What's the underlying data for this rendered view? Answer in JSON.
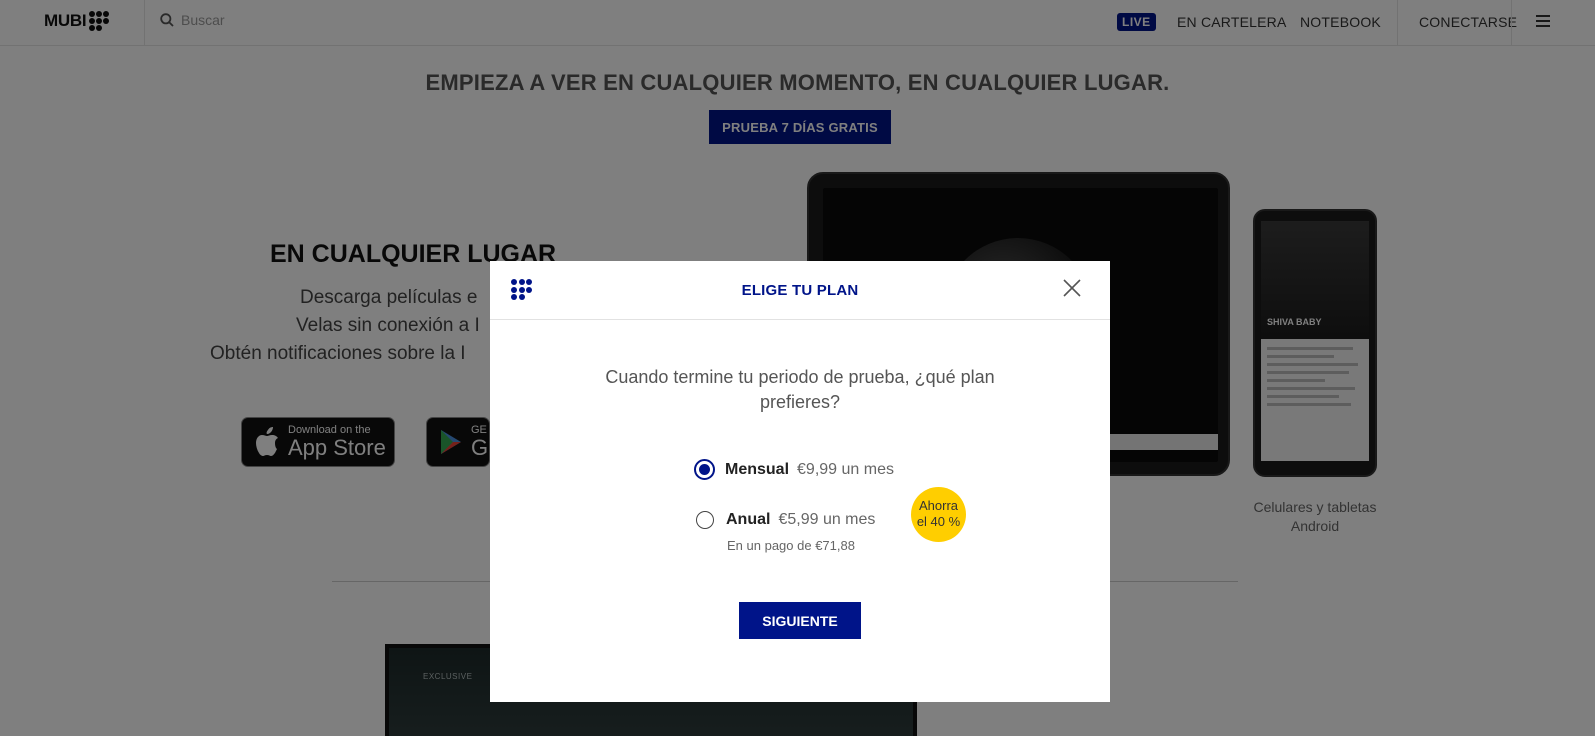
{
  "header": {
    "logo_text": "MUBI",
    "search_placeholder": "Buscar",
    "live_label": "LIVE",
    "nav_now_showing": "EN CARTELERA",
    "nav_notebook": "NOTEBOOK",
    "nav_login": "CONECTARSE"
  },
  "hero": {
    "title": "EMPIEZA A VER EN CUALQUIER MOMENTO, EN CUALQUIER LUGAR.",
    "trial_button": "PRUEBA 7 DÍAS GRATIS"
  },
  "anywhere": {
    "title": "EN CUALQUIER LUGAR",
    "features": [
      "Descarga películas e",
      "Velas sin conexión a I",
      "Obtén notificaciones sobre la I"
    ]
  },
  "stores": {
    "apple_small": "Download on the",
    "apple_big": "App Store",
    "google_small": "GE",
    "google_big": "G"
  },
  "devices": {
    "phone_film_title": "SHIVA BABY",
    "android_caption_1": "Celulares y tabletas",
    "android_caption_2": "Android",
    "laptop_label": "EXCLUSIVE"
  },
  "modal": {
    "title": "ELIGE TU PLAN",
    "question_line1": "Cuando termine tu periodo de prueba, ¿qué plan",
    "question_line2": "prefieres?",
    "plans": [
      {
        "name": "Mensual",
        "price": "€9,99 un mes",
        "selected": true
      },
      {
        "name": "Anual",
        "price": "€5,99 un mes",
        "note": "En un pago de €71,88",
        "selected": false
      }
    ],
    "save_badge_line1": "Ahorra",
    "save_badge_line2": "el 40 %",
    "next_button": "SIGUIENTE"
  },
  "colors": {
    "brand_navy": "#001489",
    "badge_yellow": "#ffce00",
    "overlay": "rgba(0,0,0,0.5)"
  },
  "icons": [
    "mubi-logo-icon",
    "search-icon",
    "menu-icon",
    "close-icon",
    "apple-icon",
    "google-play-icon"
  ]
}
